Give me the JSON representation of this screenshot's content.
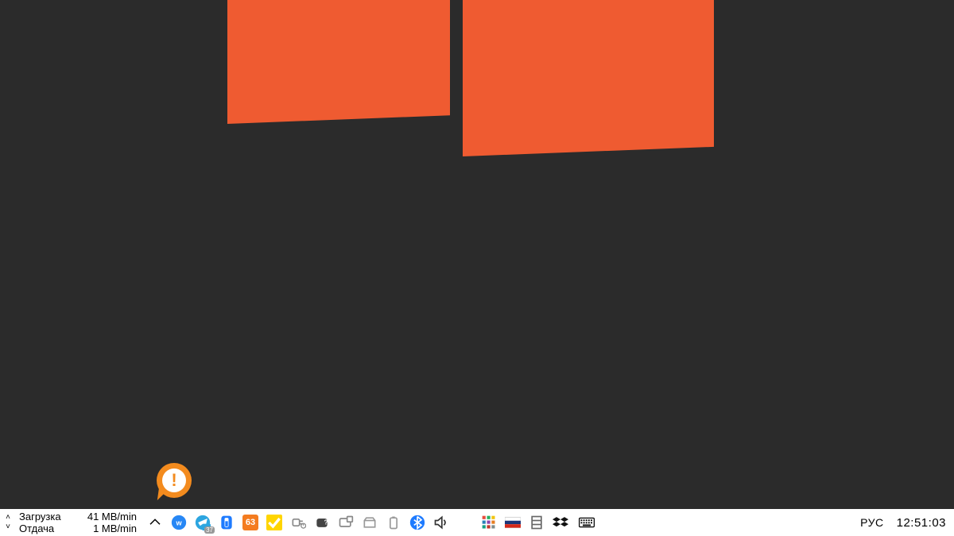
{
  "desktop": {
    "bg": "#2b2b2b",
    "logo_color": "#ef5b31"
  },
  "alert": {
    "glyph": "!"
  },
  "net": {
    "download_label": "Загрузка",
    "download_value": "41 MB/min",
    "upload_label": "Отдача",
    "upload_value": "1 MB/min"
  },
  "tray": {
    "vk": "VK",
    "telegram_badge": "37",
    "battery_manager": "battery",
    "temp_value": "63",
    "antivirus_ok": "✓",
    "power": "power",
    "gamepad_help": "?",
    "devices": "device",
    "disk": "disk",
    "battery": "battery",
    "bluetooth": "bluetooth",
    "volume": "volume",
    "color_grid": "colors",
    "flag": "RU",
    "server": "server",
    "dropbox": "dropbox",
    "keyboard": "keyboard"
  },
  "lang": "РУС",
  "clock": "12:51:03"
}
